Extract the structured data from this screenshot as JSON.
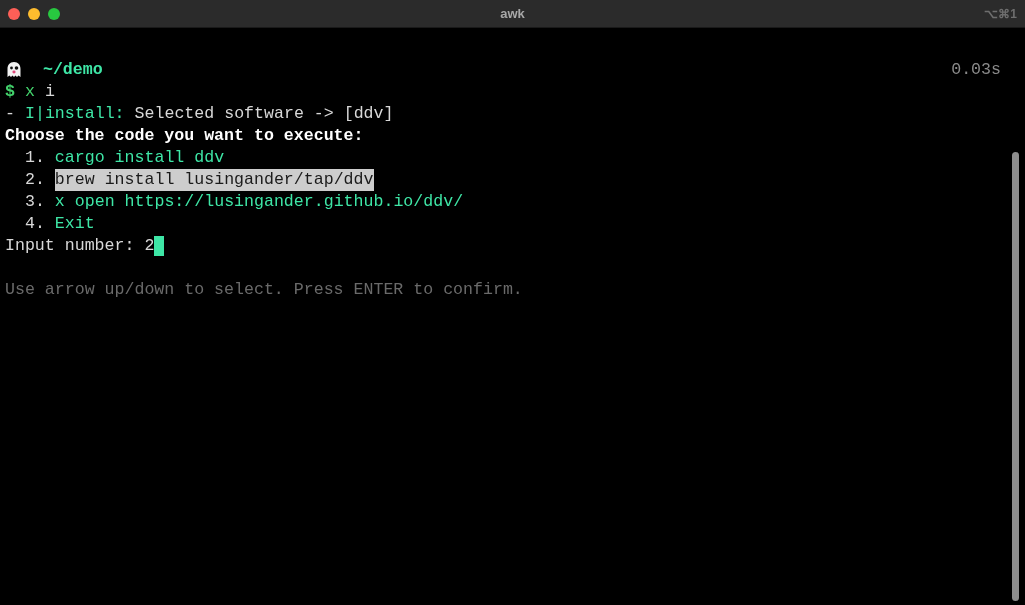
{
  "window": {
    "title": "awk",
    "shortcut": "⌥⌘1"
  },
  "prompt": {
    "path": "~/demo",
    "duration": "0.03s"
  },
  "command": {
    "symbol": "$",
    "program": "x",
    "argument": "i"
  },
  "log": {
    "prefix": "-",
    "tag": "I|install:",
    "message": "Selected software -> [ddv]"
  },
  "heading": "Choose the code you want to execute:",
  "options": [
    {
      "number": "1.",
      "label": "cargo install ddv",
      "selected": false
    },
    {
      "number": "2.",
      "label": "brew install lusingander/tap/ddv",
      "selected": true
    },
    {
      "number": "3.",
      "label": "x open https://lusingander.github.io/ddv/",
      "selected": false
    },
    {
      "number": "4.",
      "label": "Exit",
      "selected": false
    }
  ],
  "input": {
    "label": "Input number:",
    "value": "2"
  },
  "hint": "Use arrow up/down to select. Press ENTER to confirm."
}
